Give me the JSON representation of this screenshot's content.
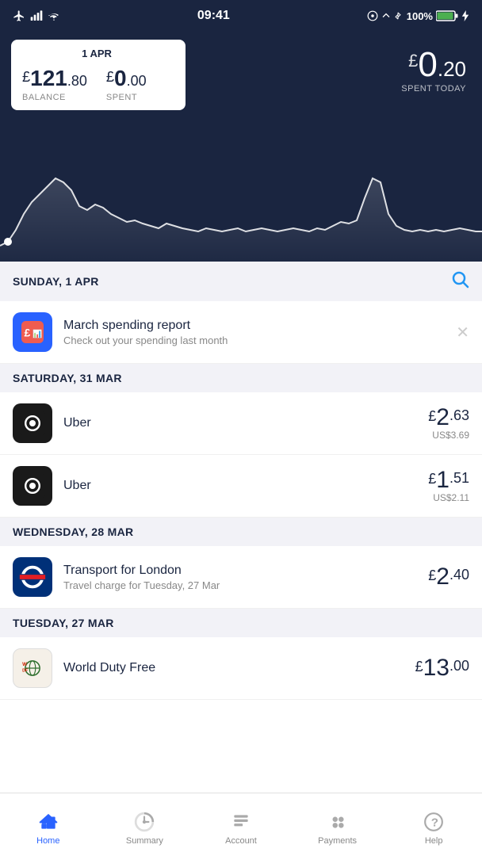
{
  "statusBar": {
    "time": "09:41",
    "battery": "100%",
    "batteryColor": "#4caf50"
  },
  "header": {
    "tooltipDate": "1 APR",
    "balance": {
      "integer": "121",
      "decimal": ".80",
      "label": "BALANCE"
    },
    "spent": {
      "integer": "0",
      "decimal": ".00",
      "label": "SPENT"
    },
    "spentToday": {
      "symbol": "£",
      "integer": "0",
      "decimal": ".20",
      "label": "SPENT TODAY"
    }
  },
  "sections": [
    {
      "id": "sun-1-apr",
      "date": "SUNDAY, 1 APR",
      "hasSearch": true,
      "items": [
        {
          "id": "march-report",
          "type": "notification",
          "iconType": "monzo",
          "title": "March spending report",
          "subtitle": "Check out your spending last month",
          "hasDismiss": true
        }
      ]
    },
    {
      "id": "sat-31-mar",
      "date": "SATURDAY, 31 MAR",
      "hasSearch": false,
      "items": [
        {
          "id": "uber-1",
          "type": "transaction",
          "iconType": "uber",
          "name": "Uber",
          "subtitle": null,
          "amountInt": "2",
          "amountDec": ".63",
          "subAmount": "US$3.69"
        },
        {
          "id": "uber-2",
          "type": "transaction",
          "iconType": "uber",
          "name": "Uber",
          "subtitle": null,
          "amountInt": "1",
          "amountDec": ".51",
          "subAmount": "US$2.11"
        }
      ]
    },
    {
      "id": "wed-28-mar",
      "date": "WEDNESDAY, 28 MAR",
      "hasSearch": false,
      "items": [
        {
          "id": "tfl-1",
          "type": "transaction",
          "iconType": "tfl",
          "name": "Transport for London",
          "subtitle": "Travel charge for Tuesday, 27 Mar",
          "amountInt": "2",
          "amountDec": ".40",
          "subAmount": null
        }
      ]
    },
    {
      "id": "tue-27-mar",
      "date": "TUESDAY, 27 MAR",
      "hasSearch": false,
      "items": [
        {
          "id": "wdf-1",
          "type": "transaction",
          "iconType": "wdf",
          "name": "World Duty Free",
          "subtitle": null,
          "amountInt": "13",
          "amountDec": ".00",
          "subAmount": null
        }
      ]
    }
  ],
  "bottomNav": {
    "items": [
      {
        "id": "home",
        "label": "Home",
        "active": true
      },
      {
        "id": "summary",
        "label": "Summary",
        "active": false
      },
      {
        "id": "account",
        "label": "Account",
        "active": false
      },
      {
        "id": "payments",
        "label": "Payments",
        "active": false
      },
      {
        "id": "help",
        "label": "Help",
        "active": false
      }
    ]
  }
}
